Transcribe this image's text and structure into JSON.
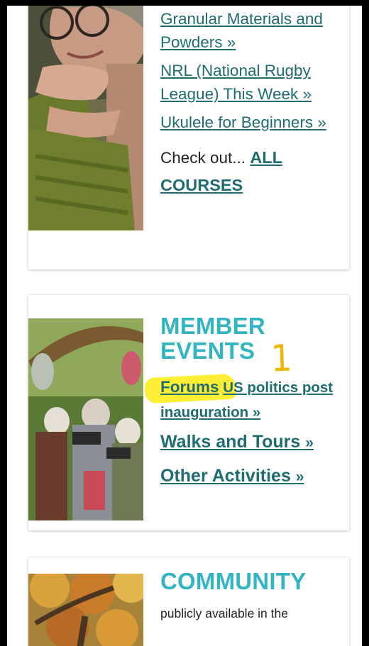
{
  "courses_card": {
    "links": [
      {
        "label": "Granular Materials and Powders »"
      },
      {
        "label": "NRL (National Rugby League) This Week »"
      },
      {
        "label": "Ukulele for Beginners »"
      }
    ],
    "check_out_prefix": "Check out...",
    "all_courses_label": "ALL COURSES"
  },
  "member_events_card": {
    "heading": "MEMBER EVENTS",
    "annotation": "1",
    "forums_label": "Forums",
    "forum_topic_label": "US politics post inauguration »",
    "walks_label": "Walks and Tours",
    "walks_raquo": "»",
    "other_label": "Other Activities",
    "other_raquo": "»"
  },
  "community_card": {
    "heading": "COMMUNITY",
    "description": "publicly available in the"
  },
  "colors": {
    "link": "#1f6d70",
    "heading": "#33b5c1",
    "highlight": "#ffee33",
    "annotation": "#f2b705"
  }
}
